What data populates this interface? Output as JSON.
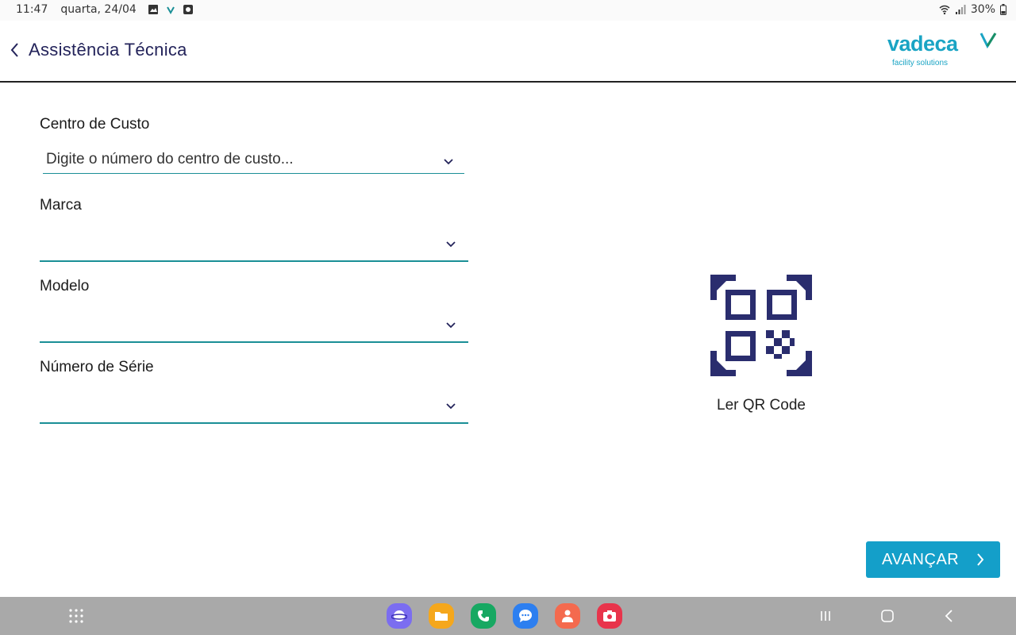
{
  "status_bar": {
    "time": "11:47",
    "date": "quarta, 24/04",
    "battery": "30%"
  },
  "header": {
    "title": "Assistência Técnica",
    "logo_text": "vadeca",
    "logo_sub": "facility solutions"
  },
  "form": {
    "cost_center": {
      "label": "Centro de Custo",
      "placeholder": "Digite o número do centro de custo..."
    },
    "brand": {
      "label": "Marca",
      "value": ""
    },
    "model": {
      "label": "Modelo",
      "value": ""
    },
    "serial": {
      "label": "Número de Série",
      "value": ""
    }
  },
  "qr": {
    "label": "Ler QR Code",
    "icon": "qr-code-scan-icon"
  },
  "next_button": {
    "label": "AVANÇAR"
  },
  "colors": {
    "accent": "#149fc9",
    "underline": "#1a8f96",
    "title": "#23235a",
    "qr_icon": "#2a2d6e",
    "navbar": "#a9a9a9"
  },
  "dock": {
    "apps": [
      {
        "name": "internet-browser-icon",
        "color": "#7b6df0"
      },
      {
        "name": "my-files-icon",
        "color": "#f5a71c"
      },
      {
        "name": "phone-icon",
        "color": "#17a862"
      },
      {
        "name": "messages-icon",
        "color": "#2d7ff0"
      },
      {
        "name": "contacts-icon",
        "color": "#f46a4e"
      },
      {
        "name": "screen-recorder-icon",
        "color": "#e8344b"
      }
    ]
  }
}
